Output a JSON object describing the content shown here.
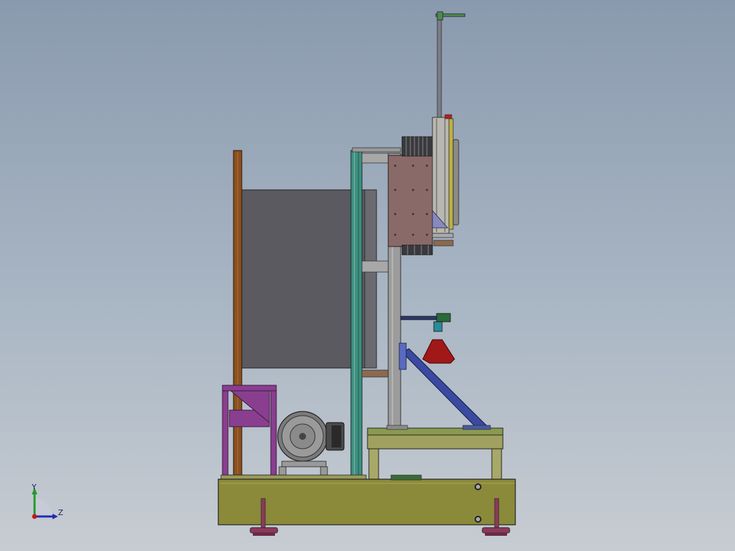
{
  "viewport": {
    "background_top": "#8a9aae",
    "background_bottom": "#c7ccd2"
  },
  "triad": {
    "y_label": "Y",
    "z_label": "Z",
    "y_color": "#1f9a2a",
    "z_color": "#1f2ab0",
    "origin_color": "#c01818"
  },
  "model": {
    "frame_color": "#8a8a3a",
    "panel_color": "#5a5a60",
    "post_color": "#8a5020",
    "column_color": "#3f8f80",
    "bracket_color": "#8a3e8f",
    "plate_color": "#8a6a68",
    "cone_color": "#a01818",
    "icons": [
      "motor-icon",
      "cone-icon",
      "leveling-foot-icon"
    ]
  }
}
